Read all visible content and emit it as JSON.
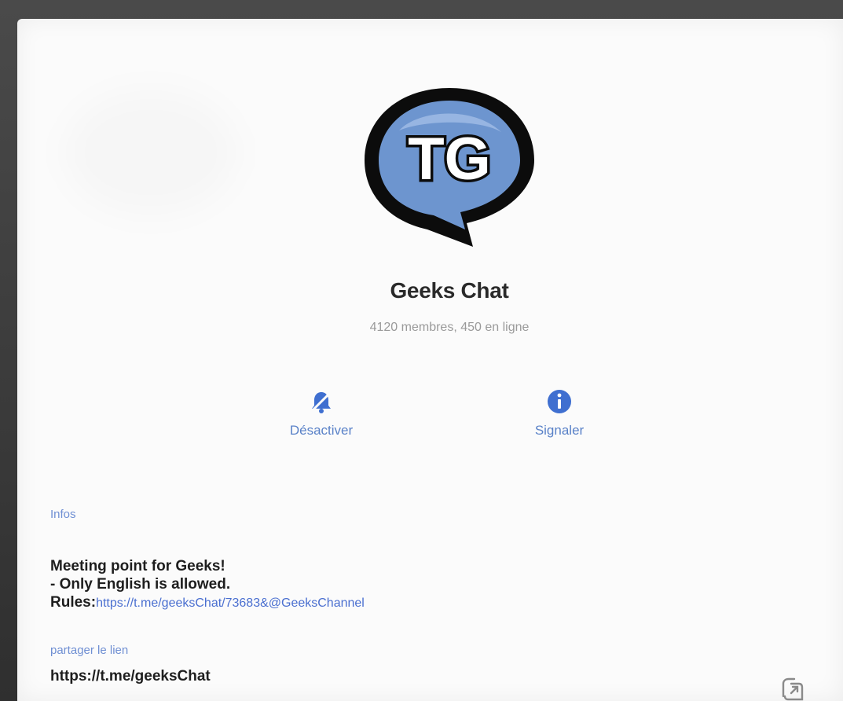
{
  "chat": {
    "title": "Geeks Chat",
    "subtitle": "4120 membres, 450 en ligne",
    "logo_text": "TG"
  },
  "actions": [
    {
      "label": "Désactiver",
      "icon": "notification-bell-icon"
    },
    {
      "label": "Signaler",
      "icon": "info-icon"
    }
  ],
  "info": {
    "section_label": "Infos",
    "lines": [
      "Meeting point for Geeks!",
      "- Only English is allowed."
    ],
    "rules_prefix": "Rules:",
    "rules_link": "https://t.me/geeksChat/73683&@GeeksChannel"
  },
  "share": {
    "section_label": "partager le lien",
    "link": "https://t.me/geeksChat",
    "icon": "share-link-icon"
  },
  "colors": {
    "accent": "#5a82c8",
    "logo_blue": "#6d95cf",
    "text": "#1e1e1e"
  }
}
